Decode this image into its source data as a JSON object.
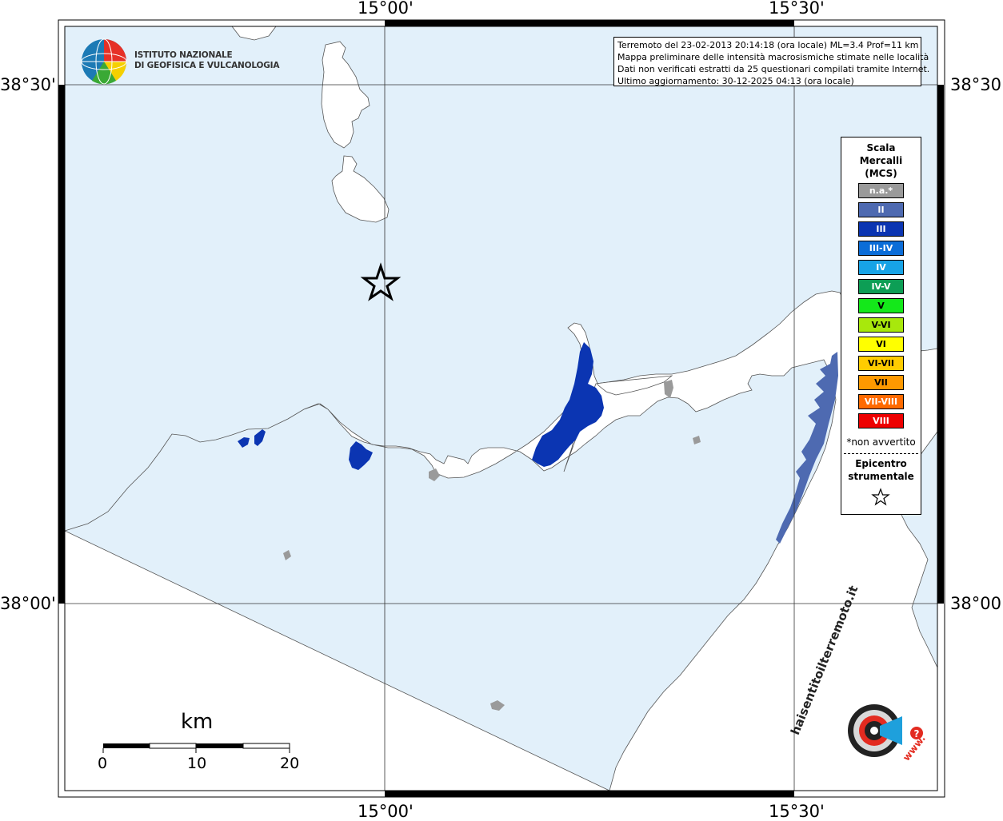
{
  "map": {
    "type": "macroseismic intensity map",
    "region_labels_on_map": [],
    "frame_longitude_labels": [
      "15°00'",
      "15°30'"
    ],
    "frame_latitude_labels": [
      "38°30'",
      "38°00'"
    ],
    "colors": {
      "sea": "#e2f0fa",
      "land": "#ffffff",
      "intensity_II": "#4e6ab1",
      "intensity_III": "#0b35b2",
      "na": "#9a9a9a",
      "frame": "#000000"
    }
  },
  "logo": {
    "line1": "ISTITUTO NAZIONALE",
    "line2": "DI GEOFISICA E VULCANOLOGIA"
  },
  "info": {
    "line1": "Terremoto del 23-02-2013 20:14:18 (ora locale) ML=3.4 Prof=11 km",
    "line2": "Mappa preliminare delle intensità macrosismiche stimate nelle località",
    "line3": "Dati non verificati estratti da 25 questionari compilati tramite Internet.",
    "line4": "Ultimo aggiornamento: 30-12-2025 04:13 (ora locale)"
  },
  "legend": {
    "title_line1": "Scala",
    "title_line2": "Mercalli",
    "title_line3": "(MCS)",
    "items": [
      {
        "label": "n.a.*",
        "color": "#9a9a9a"
      },
      {
        "label": "II",
        "color": "#4e6ab1"
      },
      {
        "label": "III",
        "color": "#0b35b2"
      },
      {
        "label": "III-IV",
        "color": "#0b6dd8"
      },
      {
        "label": "IV",
        "color": "#17a3e6"
      },
      {
        "label": "IV-V",
        "color": "#0d9e55"
      },
      {
        "label": "V",
        "color": "#14e81a"
      },
      {
        "label": "V-VI",
        "color": "#a8e80c"
      },
      {
        "label": "VI",
        "color": "#ffff00"
      },
      {
        "label": "VI-VII",
        "color": "#ffcc00"
      },
      {
        "label": "VII",
        "color": "#ff9900"
      },
      {
        "label": "VII-VIII",
        "color": "#ff6a00"
      },
      {
        "label": "VIII",
        "color": "#ee0000"
      }
    ],
    "note": "*non avvertito",
    "epicenter_line1": "Epicentro",
    "epicenter_line2": "strumentale",
    "epicenter_icon": "star-outline-icon"
  },
  "scalebar": {
    "unit": "km",
    "labels": [
      "0",
      "10",
      "20"
    ]
  },
  "badge": {
    "text_arc": "haisentitoilterremoto.it",
    "text_www": "www.",
    "icon": "megaphone-question-icon"
  }
}
